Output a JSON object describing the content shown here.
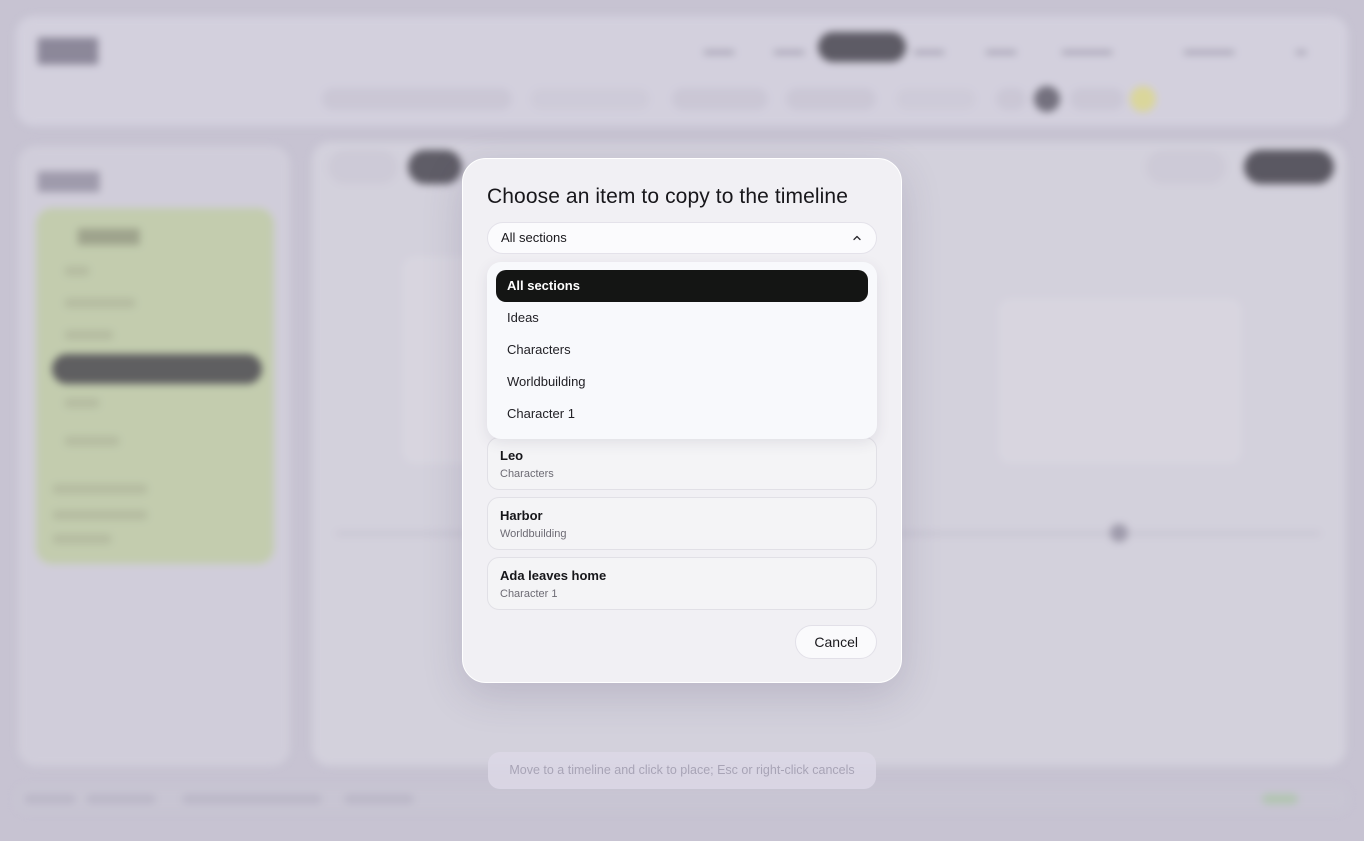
{
  "modal": {
    "title": "Choose an item to copy to the timeline",
    "section_select": {
      "value": "All sections",
      "options": [
        {
          "label": "All sections",
          "selected": true
        },
        {
          "label": "Ideas",
          "selected": false
        },
        {
          "label": "Characters",
          "selected": false
        },
        {
          "label": "Worldbuilding",
          "selected": false
        },
        {
          "label": "Character 1",
          "selected": false
        }
      ]
    },
    "items": [
      {
        "name": "Leo",
        "section": "Characters"
      },
      {
        "name": "Harbor",
        "section": "Worldbuilding"
      },
      {
        "name": "Ada leaves home",
        "section": "Character 1"
      }
    ],
    "cancel_label": "Cancel"
  },
  "hint": "Move to a timeline and click to place; Esc or right-click cancels",
  "icons": {
    "select_chevron": "chevron-up-icon"
  },
  "colors": {
    "selected_option_bg": "#141514",
    "modal_bg": "#f1f0f4",
    "sidebar_accent": "#c3d39c",
    "backdrop": "#c9c5d3"
  }
}
